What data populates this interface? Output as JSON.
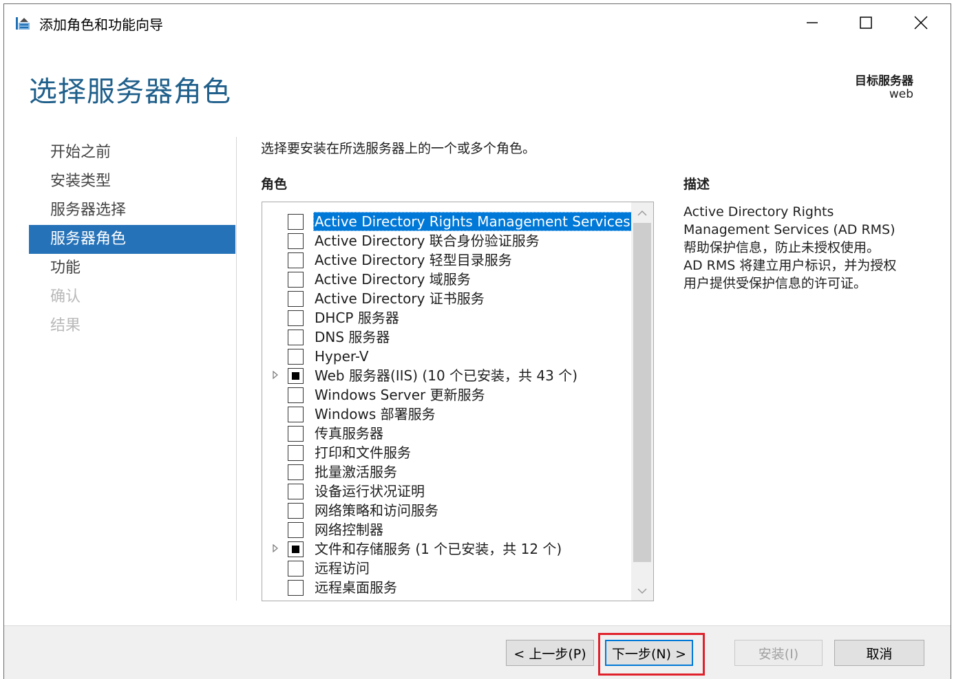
{
  "window": {
    "title": "添加角色和功能向导"
  },
  "header": {
    "page_title": "选择服务器角色",
    "target_label": "目标服务器",
    "target_value": "web"
  },
  "nav": {
    "items": [
      {
        "label": "开始之前",
        "state": "normal"
      },
      {
        "label": "安装类型",
        "state": "normal"
      },
      {
        "label": "服务器选择",
        "state": "normal"
      },
      {
        "label": "服务器角色",
        "state": "active"
      },
      {
        "label": "功能",
        "state": "normal"
      },
      {
        "label": "确认",
        "state": "disabled"
      },
      {
        "label": "结果",
        "state": "disabled"
      }
    ]
  },
  "main": {
    "instruction": "选择要安装在所选服务器上的一个或多个角色。",
    "roles_heading": "角色",
    "description_heading": "描述",
    "roles": [
      {
        "label": "Active Directory Rights Management Services",
        "checked": "none",
        "expandable": false,
        "selected": true
      },
      {
        "label": "Active Directory 联合身份验证服务",
        "checked": "none",
        "expandable": false,
        "selected": false
      },
      {
        "label": "Active Directory 轻型目录服务",
        "checked": "none",
        "expandable": false,
        "selected": false
      },
      {
        "label": "Active Directory 域服务",
        "checked": "none",
        "expandable": false,
        "selected": false
      },
      {
        "label": "Active Directory 证书服务",
        "checked": "none",
        "expandable": false,
        "selected": false
      },
      {
        "label": "DHCP 服务器",
        "checked": "none",
        "expandable": false,
        "selected": false
      },
      {
        "label": "DNS 服务器",
        "checked": "none",
        "expandable": false,
        "selected": false
      },
      {
        "label": "Hyper-V",
        "checked": "none",
        "expandable": false,
        "selected": false
      },
      {
        "label": "Web 服务器(IIS) (10 个已安装，共 43 个)",
        "checked": "partial",
        "expandable": true,
        "selected": false
      },
      {
        "label": "Windows Server 更新服务",
        "checked": "none",
        "expandable": false,
        "selected": false
      },
      {
        "label": "Windows 部署服务",
        "checked": "none",
        "expandable": false,
        "selected": false
      },
      {
        "label": "传真服务器",
        "checked": "none",
        "expandable": false,
        "selected": false
      },
      {
        "label": "打印和文件服务",
        "checked": "none",
        "expandable": false,
        "selected": false
      },
      {
        "label": "批量激活服务",
        "checked": "none",
        "expandable": false,
        "selected": false
      },
      {
        "label": "设备运行状况证明",
        "checked": "none",
        "expandable": false,
        "selected": false
      },
      {
        "label": "网络策略和访问服务",
        "checked": "none",
        "expandable": false,
        "selected": false
      },
      {
        "label": "网络控制器",
        "checked": "none",
        "expandable": false,
        "selected": false
      },
      {
        "label": "文件和存储服务 (1 个已安装，共 12 个)",
        "checked": "partial",
        "expandable": true,
        "selected": false
      },
      {
        "label": "远程访问",
        "checked": "none",
        "expandable": false,
        "selected": false
      },
      {
        "label": "远程桌面服务",
        "checked": "none",
        "expandable": false,
        "selected": false
      }
    ],
    "description_lines": [
      "Active Directory Rights",
      "Management Services (AD RMS)",
      "帮助保护信息，防止未授权使用。",
      "AD RMS 将建立用户标识，并为授权",
      "用户提供受保护信息的许可证。"
    ]
  },
  "footer": {
    "prev_label": "< 上一步(P)",
    "next_label": "下一步(N) >",
    "install_label": "安装(I)",
    "cancel_label": "取消"
  },
  "colors": {
    "accent": "#2672b8",
    "title_blue": "#1f5f8b",
    "selection": "#0078d7",
    "highlight_red": "#e0202a"
  }
}
